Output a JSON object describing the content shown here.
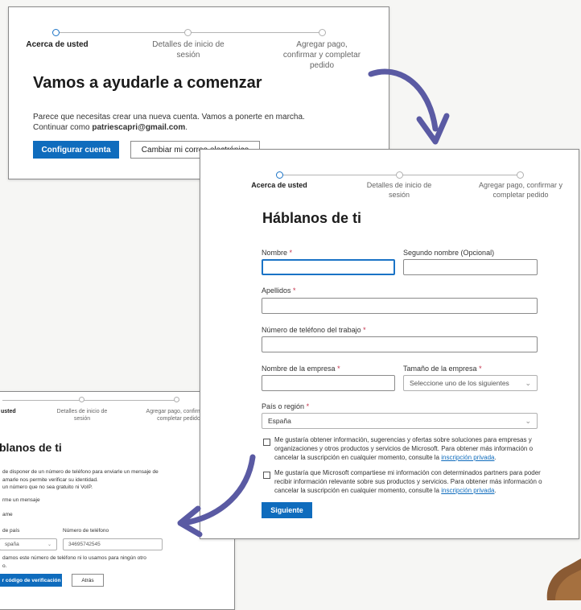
{
  "steps": {
    "about": "Acerca de usted",
    "login": "Detalles de inicio de sesión",
    "payment": "Agregar pago, confirmar y completar pedido"
  },
  "card1": {
    "title": "Vamos a ayudarle a comenzar",
    "line1": "Parece que necesitas crear una nueva cuenta. Vamos a ponerte en marcha.",
    "continue_prefix": "Continuar como ",
    "email": "patriescapri@gmail.com",
    "continue_suffix": ".",
    "setup_button": "Configurar cuenta",
    "change_button": "Cambiar mi correo electrónico"
  },
  "card2": {
    "title": "Háblanos de ti",
    "first_name_label": "Nombre",
    "middle_name_label": "Segundo nombre (Opcional)",
    "last_name_label": "Apellidos",
    "work_phone_label": "Número de teléfono del trabajo",
    "company_label": "Nombre de la empresa",
    "company_size_label": "Tamaño de la empresa",
    "company_size_placeholder": "Seleccione uno de los siguientes",
    "country_label": "País o región",
    "country_value": "España",
    "required_mark": "*",
    "checkbox1_text": "Me gustaría obtener información, sugerencias y ofertas sobre soluciones para empresas y organizaciones y otros productos y servicios de Microsoft. Para obtener más información o cancelar la suscripción en cualquier momento, consulte la",
    "checkbox2_text": "Me gustaría que Microsoft compartiese mi información con determinados partners para poder recibir información relevante sobre sus productos y servicios. Para obtener más información o cancelar la suscripción en cualquier momento, consulte la",
    "privacy_link": "inscripción privada",
    "period": ".",
    "next_button": "Siguiente"
  },
  "card3": {
    "step_about": "usted",
    "title": "blanos de ti",
    "text1": "de disponer de un número de teléfono para enviarle un mensaje de",
    "text2": "amarle nos permite verificar su identidad.",
    "text3": "un número que no sea gratuito ni VoIP.",
    "opt_msg": "rme un mensaje",
    "opt_call": "ame",
    "country_code_label": "de país",
    "phone_label": "Número de teléfono",
    "country_value": "spaña",
    "phone_value": "34695742545",
    "note1": "damos este número de teléfono ni lo usamos para ningún otro",
    "note2": "o.",
    "send_button": "r código de verificación",
    "back_button": "Atrás"
  },
  "colors": {
    "accent": "#0f6cbd",
    "arrow": "#5a5aa3",
    "required": "#c4314b"
  }
}
